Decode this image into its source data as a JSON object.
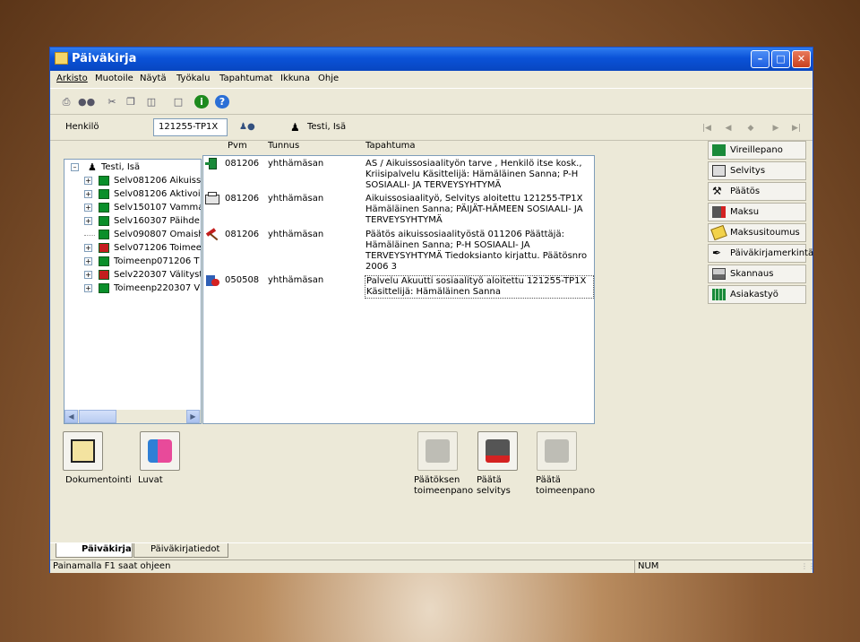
{
  "window": {
    "title": "Päiväkirja"
  },
  "menu": [
    "Arkisto",
    "Muotoile",
    "Näytä",
    "Työkalu",
    "Tapahtumat",
    "Ikkuna",
    "Ohje"
  ],
  "henkilo": {
    "label": "Henkilö",
    "value": "121255-TP1X",
    "person_name": "Testi, Isä"
  },
  "columns": {
    "pvm": "Pvm",
    "tunnus": "Tunnus",
    "tapahtuma": "Tapahtuma"
  },
  "tree": {
    "root": "Testi, Isä",
    "items": [
      {
        "label": "Selv081206 Aikuiss",
        "color": "#0a8f2a"
      },
      {
        "label": "Selv081206 Aktivoi",
        "color": "#0a8f2a"
      },
      {
        "label": "Selv150107 Vamma",
        "color": "#0a8f2a"
      },
      {
        "label": "Selv160307 Päihde",
        "color": "#0a8f2a"
      },
      {
        "label": "Selv090807 Omaish",
        "color": "#0a8f2a"
      },
      {
        "label": "Selv071206 Toimee",
        "color": "#c41e1e"
      },
      {
        "label": "Toimeenp071206 T",
        "color": "#0a8f2a"
      },
      {
        "label": "Selv220307 Välityst",
        "color": "#c41e1e"
      },
      {
        "label": "Toimeenp220307 V",
        "color": "#0a8f2a"
      }
    ]
  },
  "events": [
    {
      "date": "081206",
      "code": "yhthämäsan",
      "lines": [
        "AS / Aikuissosiaalityön tarve , Henkilö itse kosk.,",
        "Kriisipalvelu  Käsittelijä: Hämäläinen Sanna; P-H",
        "SOSIAALI- JA TERVEYSYHTYMÄ"
      ]
    },
    {
      "date": "081206",
      "code": "yhthämäsan",
      "lines": [
        "Aikuissosiaalityö, Selvitys aloitettu 121255-TP1X",
        "Hämäläinen Sanna; PÄIJÄT-HÄMEEN SOSIAALI- JA",
        "TERVEYSYHTYMÄ"
      ]
    },
    {
      "date": "081206",
      "code": "yhthämäsan",
      "lines": [
        "Päätös aikuissosiaalityöstä 011206  Päättäjä:",
        "Hämäläinen Sanna; P-H SOSIAALI- JA",
        "TERVEYSYHTYMÄ  Tiedoksianto kirjattu.  Päätösnro",
        "2006 3"
      ]
    },
    {
      "date": "050508",
      "code": "yhthämäsan",
      "lines": [
        "Palvelu Akuutti sosiaalityö aloitettu 121255-TP1X",
        "Käsittelijä: Hämäläinen Sanna"
      ]
    }
  ],
  "right_buttons": [
    "Vireillepano",
    "Selvitys",
    "Päätös",
    "Maksu",
    "Maksusitoumus",
    "Päiväkirjamerkintä",
    "Skannaus",
    "Asiakastyö"
  ],
  "bottom_buttons": {
    "dokumentointi": "Dokumentointi",
    "luvat": "Luvat",
    "paatoksen_toimeenpano": [
      "Päätöksen",
      "toimeenpano"
    ],
    "paata_selvitys": [
      "Päätä",
      "selvitys"
    ],
    "paata_toimeenpano": [
      "Päätä",
      "toimeenpano"
    ]
  },
  "tabs": [
    "Päiväkirja",
    "Päiväkirjatiedot"
  ],
  "status": {
    "help": "Painamalla F1 saat ohjeen",
    "num": "NUM"
  }
}
